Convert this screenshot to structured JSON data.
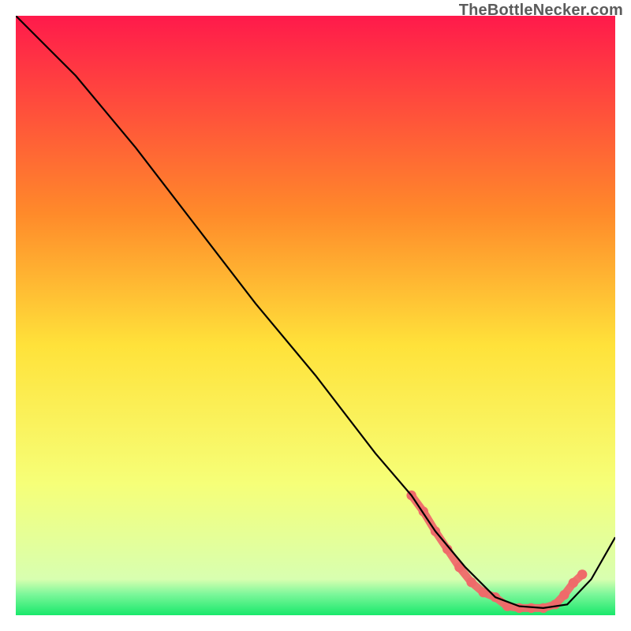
{
  "watermark": "TheBottleNecker.com",
  "gradient": {
    "start": "#ff1a4b",
    "mid1": "#ff7a2a",
    "mid2": "#ffe23a",
    "mid3": "#f6ff78",
    "end": "#19e86b",
    "stops": [
      {
        "offset": 0.0,
        "color": "#ff1a4b"
      },
      {
        "offset": 0.33,
        "color": "#ff8a2a"
      },
      {
        "offset": 0.55,
        "color": "#ffe23a"
      },
      {
        "offset": 0.78,
        "color": "#f6ff78"
      },
      {
        "offset": 0.94,
        "color": "#d8ffb0"
      },
      {
        "offset": 0.965,
        "color": "#7cf79a"
      },
      {
        "offset": 1.0,
        "color": "#19e86b"
      }
    ]
  },
  "chart_data": {
    "type": "line",
    "title": "",
    "xlabel": "",
    "ylabel": "",
    "xlim": [
      0,
      100
    ],
    "ylim": [
      0,
      100
    ],
    "series": [
      {
        "name": "curve",
        "color": "#000000",
        "x": [
          0,
          6,
          10,
          20,
          30,
          40,
          50,
          60,
          66,
          70,
          75,
          80,
          84,
          88,
          92,
          96,
          100
        ],
        "y": [
          100,
          94,
          90,
          78,
          65,
          52,
          40,
          27,
          20,
          14,
          8,
          3,
          1.5,
          1.2,
          1.8,
          6,
          13
        ]
      }
    ],
    "highlight_band": {
      "color": "#ef6a6a",
      "dot_radius": 0.9,
      "x": [
        66,
        68,
        70,
        72,
        74,
        76,
        78,
        80,
        82,
        84,
        86,
        88,
        90,
        91.5,
        93,
        94.5
      ],
      "y": [
        20,
        17.3,
        14,
        11,
        8,
        5.5,
        3.8,
        3,
        1.5,
        1.2,
        1.2,
        1.2,
        1.8,
        3.4,
        5.4,
        6.8
      ]
    }
  }
}
